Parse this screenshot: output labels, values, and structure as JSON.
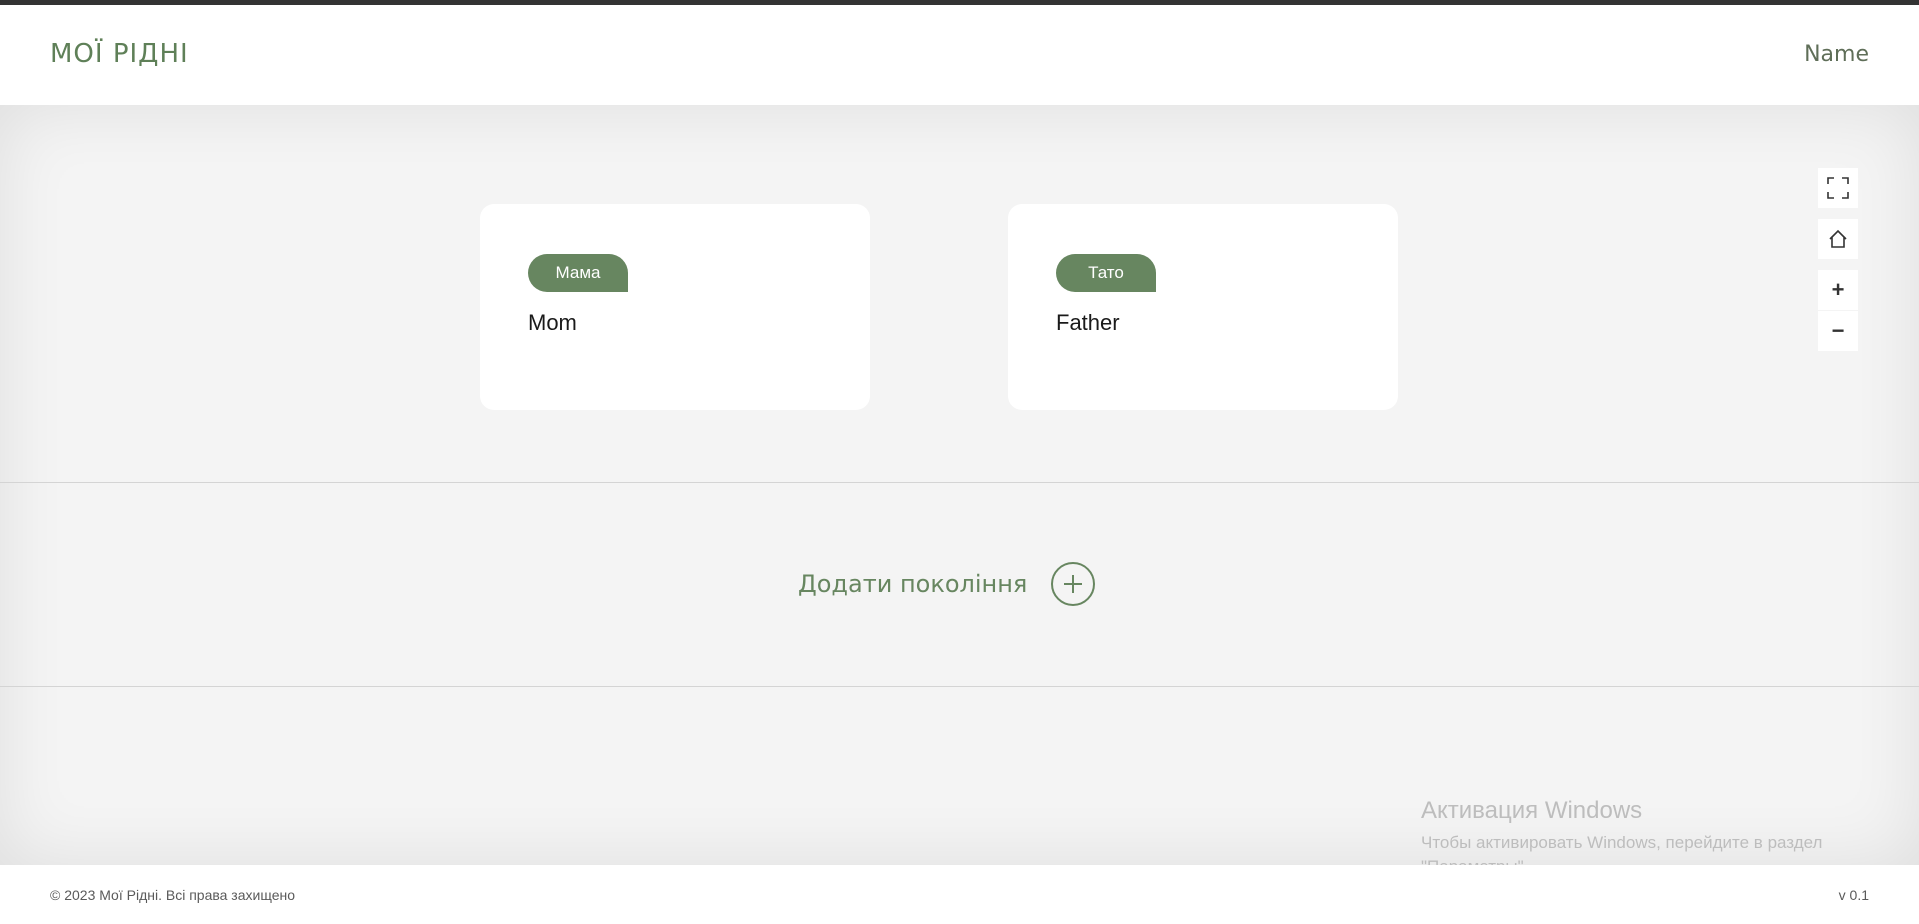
{
  "header": {
    "logo": "МОЇ РІДНІ",
    "user_name": "Name"
  },
  "tree": {
    "cards": [
      {
        "role": "Мама",
        "name": "Mom"
      },
      {
        "role": "Тато",
        "name": "Father"
      }
    ],
    "add_generation_label": "Додати покоління"
  },
  "controls": {
    "fullscreen_icon": "fullscreen-icon",
    "home_icon": "home-icon",
    "zoom_in": "+",
    "zoom_out": "−"
  },
  "watermark": {
    "title": "Активация Windows",
    "text": "Чтобы активировать Windows, перейдите в раздел \"Параметры\"."
  },
  "footer": {
    "copyright": "© 2023 Мої Рідні. Всі права захищено",
    "version": "v 0.1"
  },
  "colors": {
    "accent": "#678660",
    "topbar": "#333333",
    "background": "#f4f4f4"
  }
}
